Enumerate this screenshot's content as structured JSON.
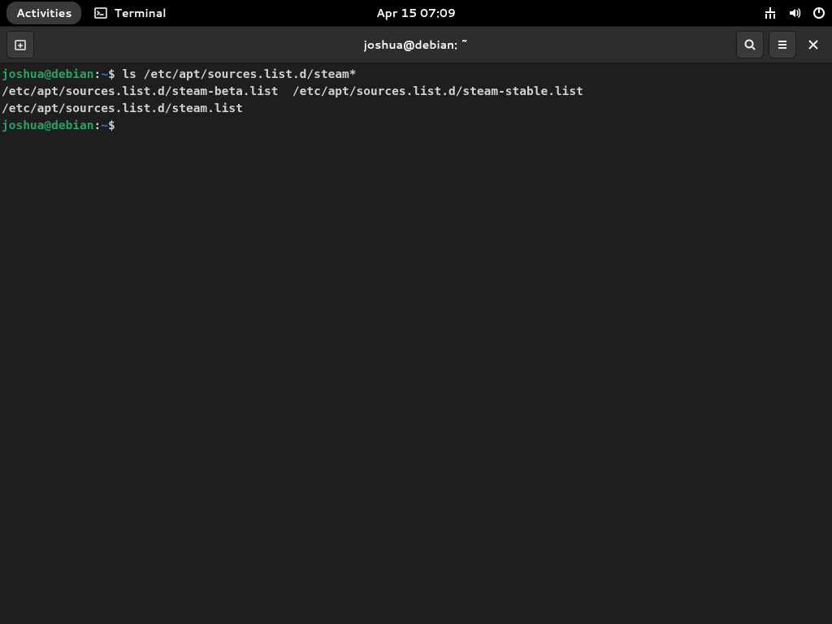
{
  "topbar": {
    "activities": "Activities",
    "app_name": "Terminal",
    "datetime": "Apr 15  07:09"
  },
  "window": {
    "title": "joshua@debian: ~"
  },
  "terminal": {
    "prompt1": {
      "user_host": "joshua@debian",
      "separator": ":",
      "path": "~",
      "dollar": "$ ",
      "command": "ls /etc/apt/sources.list.d/steam*"
    },
    "output_line1": "/etc/apt/sources.list.d/steam-beta.list  /etc/apt/sources.list.d/steam-stable.list",
    "output_line2": "/etc/apt/sources.list.d/steam.list",
    "prompt2": {
      "user_host": "joshua@debian",
      "separator": ":",
      "path": "~",
      "dollar": "$ "
    }
  }
}
